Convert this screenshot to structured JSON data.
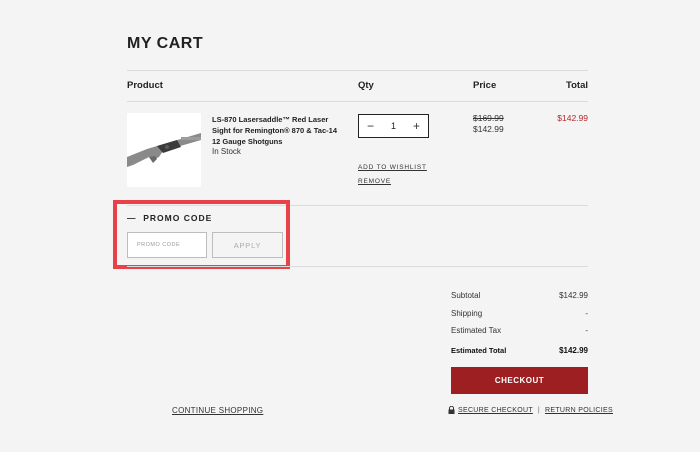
{
  "cart": {
    "title": "MY CART",
    "columns": {
      "product": "Product",
      "qty": "Qty",
      "price": "Price",
      "total": "Total"
    },
    "item": {
      "name": "LS-870 Lasersaddle™ Red Laser Sight for Remington® 870 & Tac-14 12 Gauge Shotguns",
      "stock": "In Stock",
      "qty": "1",
      "qty_minus": "−",
      "qty_plus": "+",
      "add_to_wishlist": "ADD TO WISHLIST",
      "remove": "REMOVE",
      "price_original": "$169.99",
      "price_sale": "$142.99",
      "total": "$142.99"
    }
  },
  "promo": {
    "toggle": "—",
    "title": "PROMO CODE",
    "placeholder": "PROMO CODE",
    "apply": "APPLY"
  },
  "summary": {
    "subtotal_label": "Subtotal",
    "subtotal_value": "$142.99",
    "shipping_label": "Shipping",
    "shipping_value": "-",
    "tax_label": "Estimated Tax",
    "tax_value": "-",
    "total_label": "Estimated Total",
    "total_value": "$142.99",
    "checkout": "CHECKOUT"
  },
  "footer": {
    "continue_shopping": "CONTINUE SHOPPING",
    "secure_checkout": "SECURE CHECKOUT",
    "separator": "|",
    "return_policies": "RETURN POLICIES"
  },
  "colors": {
    "accent_red": "#9e1f22",
    "highlight_border": "#e8414a",
    "sale_red": "#b5262b"
  }
}
